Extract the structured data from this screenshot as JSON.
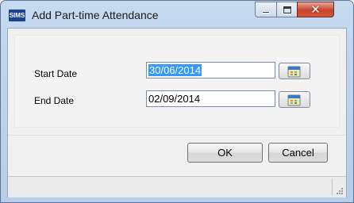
{
  "window": {
    "title": "Add Part-time Attendance",
    "app_icon": "SIMS",
    "icons": {
      "app": "sims-app-icon",
      "minimize": "minimize-icon",
      "maximize": "maximize-icon",
      "close": "close-icon"
    }
  },
  "form": {
    "start_date": {
      "label": "Start Date",
      "value": "30/06/2014",
      "selected": true,
      "picker_icon": "calendar-icon"
    },
    "end_date": {
      "label": "End Date",
      "value": "02/09/2014",
      "picker_icon": "calendar-icon"
    }
  },
  "buttons": {
    "ok": "OK",
    "cancel": "Cancel"
  },
  "colors": {
    "title_bar": "#c6daf0",
    "close_button": "#c7432a",
    "selection": "#3399ff",
    "client_background": "#f0f0f0"
  }
}
